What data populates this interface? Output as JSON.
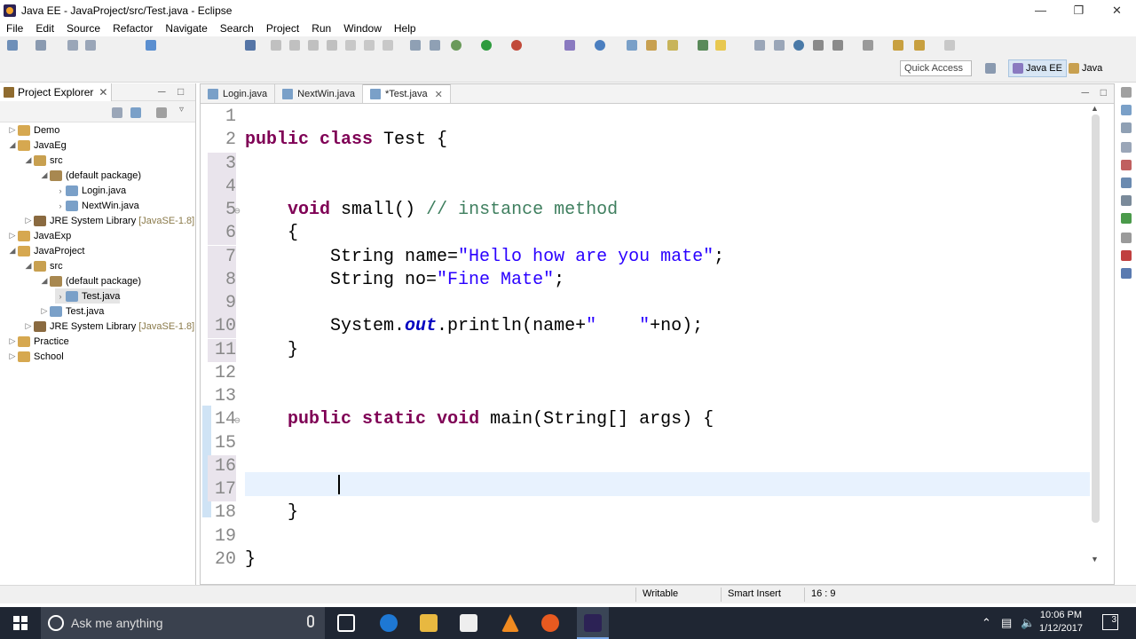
{
  "window": {
    "title": "Java EE - JavaProject/src/Test.java - Eclipse"
  },
  "menu": [
    "File",
    "Edit",
    "Source",
    "Refactor",
    "Navigate",
    "Search",
    "Project",
    "Run",
    "Window",
    "Help"
  ],
  "toolbar": {
    "quick_access_placeholder": "Quick Access",
    "perspectives": [
      "Java EE",
      "Java"
    ]
  },
  "project_explorer": {
    "title": "Project Explorer",
    "tree": [
      {
        "label": "Demo",
        "level": 0,
        "expanded": false,
        "type": "project"
      },
      {
        "label": "JavaEg",
        "level": 0,
        "expanded": true,
        "type": "project"
      },
      {
        "label": "src",
        "level": 1,
        "expanded": true,
        "type": "srcfolder"
      },
      {
        "label": "(default package)",
        "level": 2,
        "expanded": true,
        "type": "package"
      },
      {
        "label": "Login.java",
        "level": 3,
        "expanded": false,
        "type": "java"
      },
      {
        "label": "NextWin.java",
        "level": 3,
        "expanded": false,
        "type": "java"
      },
      {
        "label": "JRE System Library",
        "lib": "[JavaSE-1.8]",
        "level": 1,
        "expanded": false,
        "type": "lib"
      },
      {
        "label": "JavaExp",
        "level": 0,
        "expanded": false,
        "type": "project"
      },
      {
        "label": "JavaProject",
        "level": 0,
        "expanded": true,
        "type": "project"
      },
      {
        "label": "src",
        "level": 1,
        "expanded": true,
        "type": "srcfolder"
      },
      {
        "label": "(default package)",
        "level": 2,
        "expanded": true,
        "type": "package"
      },
      {
        "label": "Test.java",
        "level": 3,
        "expanded": false,
        "type": "java",
        "selected": true
      },
      {
        "label": "Test.java",
        "level": 2,
        "expanded": false,
        "type": "java"
      },
      {
        "label": "JRE System Library",
        "lib": "[JavaSE-1.8]",
        "level": 1,
        "expanded": false,
        "type": "lib"
      },
      {
        "label": "Practice",
        "level": 0,
        "expanded": false,
        "type": "project"
      },
      {
        "label": "School",
        "level": 0,
        "expanded": false,
        "type": "project"
      }
    ]
  },
  "editor": {
    "tabs": [
      {
        "label": "Login.java",
        "active": false
      },
      {
        "label": "NextWin.java",
        "active": false
      },
      {
        "label": "*Test.java",
        "active": true
      }
    ],
    "lines": [
      {
        "n": "1",
        "code": ""
      },
      {
        "n": "2",
        "code": "public class Test {"
      },
      {
        "n": "3",
        "code": ""
      },
      {
        "n": "4",
        "code": ""
      },
      {
        "n": "5",
        "code": "    void small() // instance method"
      },
      {
        "n": "6",
        "code": "    {"
      },
      {
        "n": "7",
        "code": "        String name=\"Hello how are you mate\";"
      },
      {
        "n": "8",
        "code": "        String no=\"Fine Mate\";"
      },
      {
        "n": "9",
        "code": ""
      },
      {
        "n": "10",
        "code": "        System.out.println(name+\"    \"+no);"
      },
      {
        "n": "11",
        "code": "    }"
      },
      {
        "n": "12",
        "code": ""
      },
      {
        "n": "13",
        "code": ""
      },
      {
        "n": "14",
        "code": "    public static void main(String[] args) {"
      },
      {
        "n": "15",
        "code": ""
      },
      {
        "n": "16",
        "code": ""
      },
      {
        "n": "17",
        "code": ""
      },
      {
        "n": "18",
        "code": "    }"
      },
      {
        "n": "19",
        "code": ""
      },
      {
        "n": "20",
        "code": "}"
      }
    ]
  },
  "status": {
    "mode": "Writable",
    "insert": "Smart Insert",
    "position": "16 : 9"
  },
  "taskbar": {
    "search_placeholder": "Ask me anything",
    "time": "10:06 PM",
    "date": "1/12/2017",
    "notifications": "3"
  }
}
